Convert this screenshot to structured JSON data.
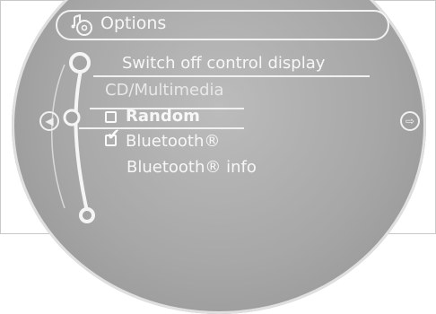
{
  "header": {
    "title": "Options",
    "icon": "music-options-icon"
  },
  "menu": {
    "switch_off": "Switch off control display",
    "section_label": "CD/Multimedia",
    "random": {
      "label": "Random",
      "checked": false
    },
    "bluetooth": {
      "label": "Bluetooth®",
      "checked": true
    },
    "bluetooth_info": "Bluetooth® info"
  },
  "nav": {
    "left": "left-arrow-icon",
    "right": "right-arrow-icon"
  },
  "colors": {
    "display_bg": "#a7a7a7",
    "foreground": "#f7f7f7"
  }
}
